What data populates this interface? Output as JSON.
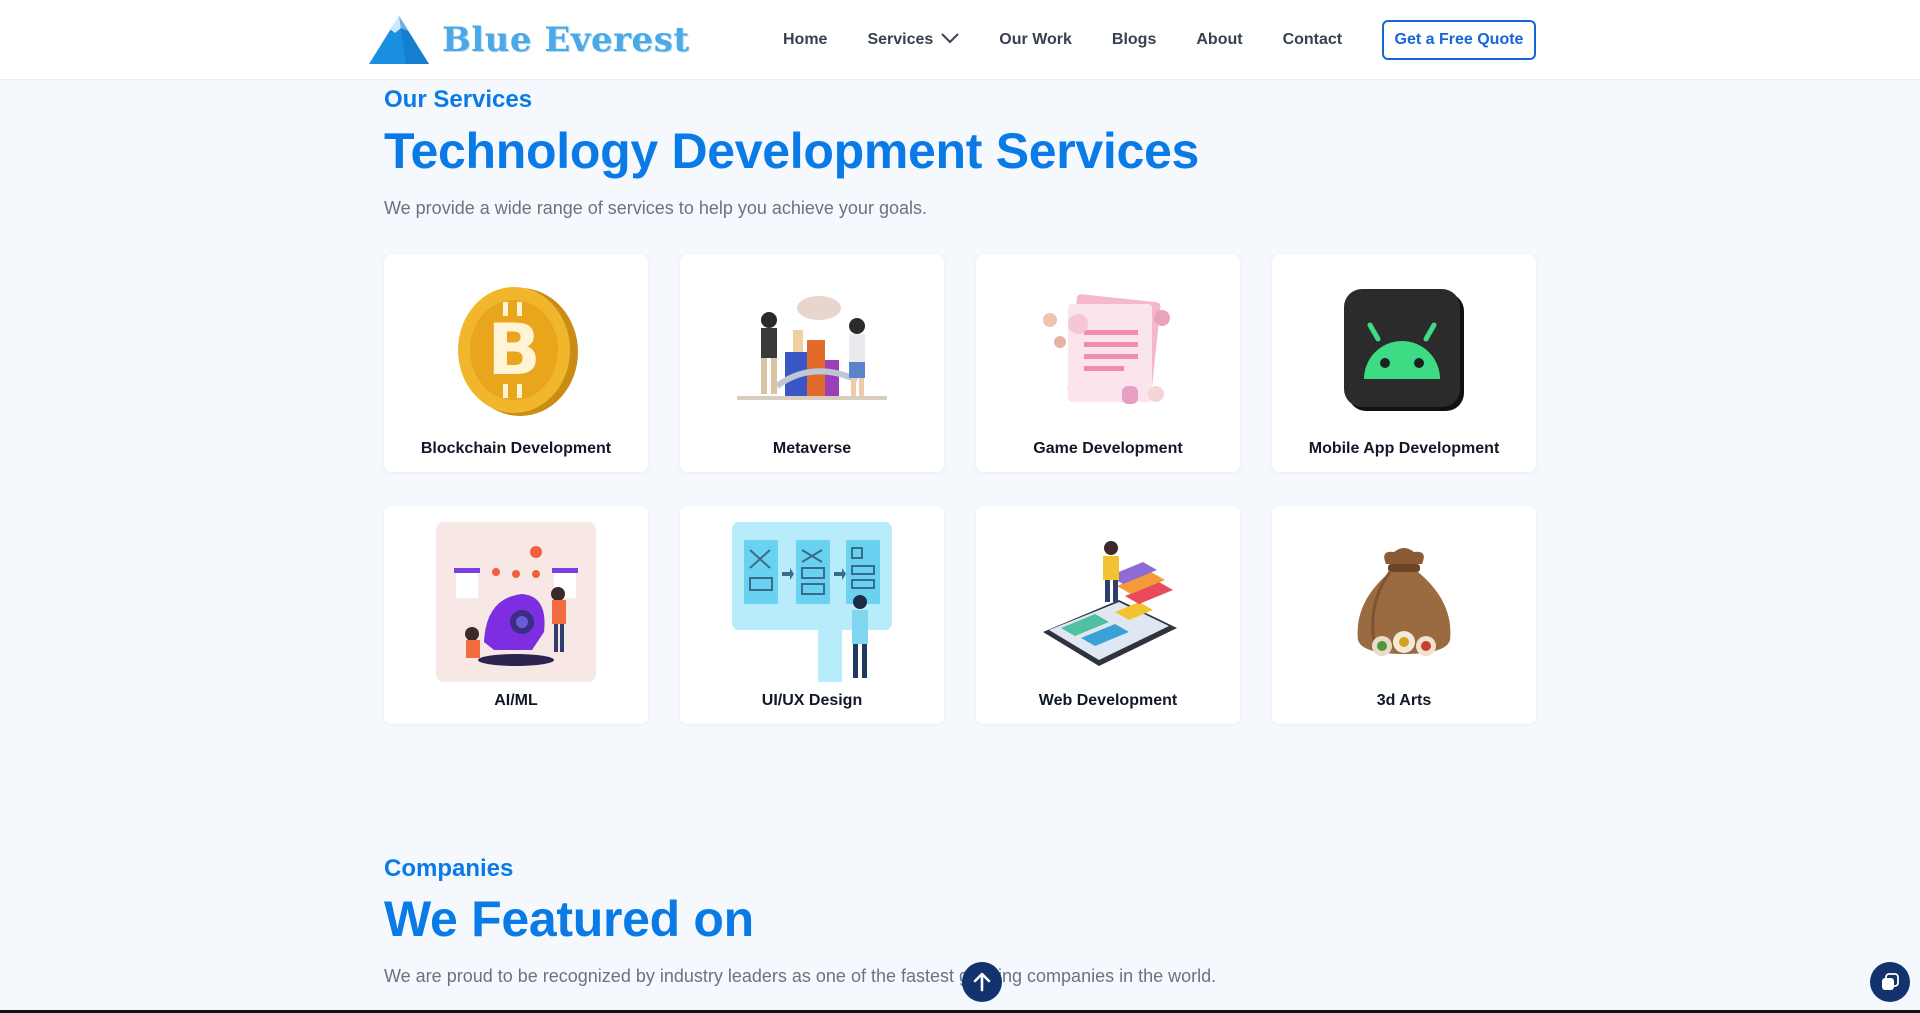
{
  "brand": {
    "name": "Blue Everest"
  },
  "nav": {
    "items": [
      "Home",
      "Services",
      "Our Work",
      "Blogs",
      "About",
      "Contact"
    ],
    "cta": "Get a Free Quote"
  },
  "services": {
    "eyebrow": "Our Services",
    "title": "Technology Development Services",
    "subtitle": "We provide a wide range of services to help you achieve your goals.",
    "cards": [
      {
        "label": "Blockchain Development",
        "icon": "bitcoin-coin-icon"
      },
      {
        "label": "Metaverse",
        "icon": "metaverse-illustration"
      },
      {
        "label": "Game Development",
        "icon": "game-document-illustration"
      },
      {
        "label": "Mobile App Development",
        "icon": "android-icon"
      },
      {
        "label": "AI/ML",
        "icon": "ai-robot-illustration"
      },
      {
        "label": "UI/UX Design",
        "icon": "wireframe-board-illustration"
      },
      {
        "label": "Web Development",
        "icon": "phone-web-illustration"
      },
      {
        "label": "3d Arts",
        "icon": "sack-3d-illustration"
      }
    ]
  },
  "companies": {
    "eyebrow": "Companies",
    "title": "We Featured on",
    "subtitle": "We are proud to be recognized by industry leaders as one of the fastest growing companies in the world."
  },
  "colors": {
    "accent": "#0a7ae6",
    "button": "#1565d8",
    "floating": "#12336e",
    "background": "#f5f9fe"
  }
}
